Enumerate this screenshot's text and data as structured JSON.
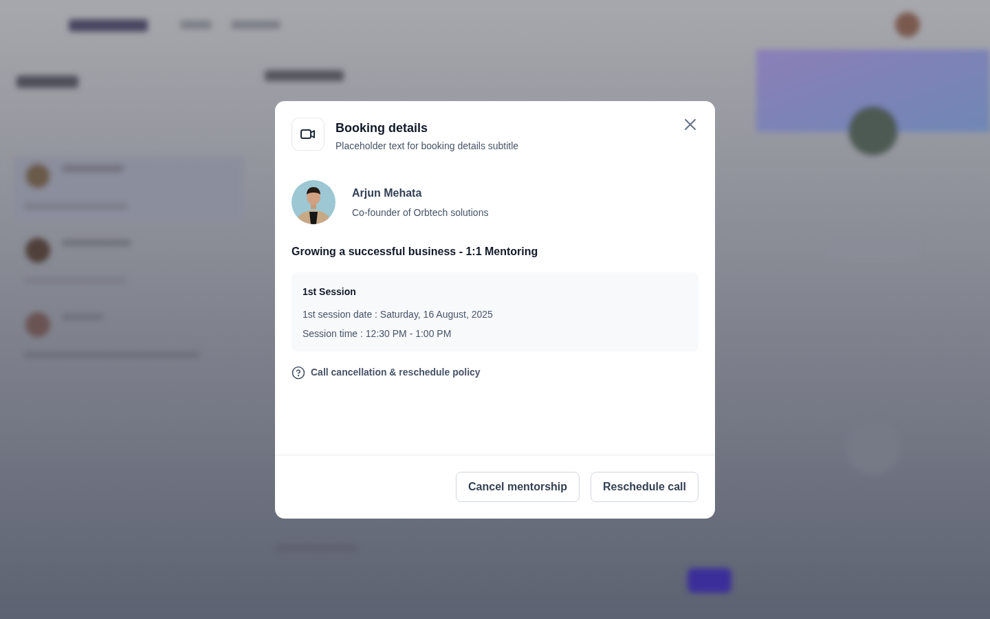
{
  "modal": {
    "title": "Booking details",
    "subtitle": "Placeholder text for booking details subtitle",
    "mentor": {
      "name": "Arjun Mehata",
      "role": "Co-founder of Orbtech solutions"
    },
    "program": "Growing a successful business - 1:1 Mentoring",
    "session": {
      "heading": "1st Session",
      "lines": [
        "1st session date : Saturday, 16 August, 2025",
        "Session time : 12:30 PM - 1:00 PM"
      ]
    },
    "policy_link": "Call cancellation & reschedule policy",
    "buttons": [
      {
        "label": "Cancel mentorship"
      },
      {
        "label": "Reschedule call"
      }
    ]
  }
}
